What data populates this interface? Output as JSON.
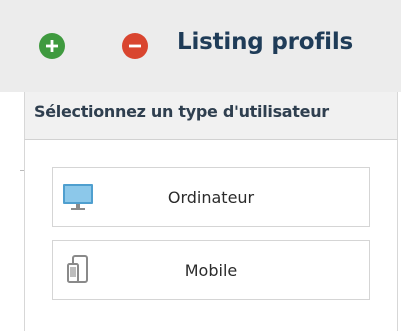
{
  "header": {
    "title": "Listing profils",
    "add_icon": "plus-circle-icon",
    "remove_icon": "minus-circle-icon",
    "colors": {
      "add": "#3f9a3f",
      "remove": "#d9452f",
      "title": "#1f3c58"
    }
  },
  "panel": {
    "subtitle": "Sélectionnez un type d'utilisateur",
    "options": [
      {
        "label": "Ordinateur",
        "icon": "desktop-monitor-icon"
      },
      {
        "label": "Mobile",
        "icon": "mobile-device-icon"
      }
    ]
  }
}
